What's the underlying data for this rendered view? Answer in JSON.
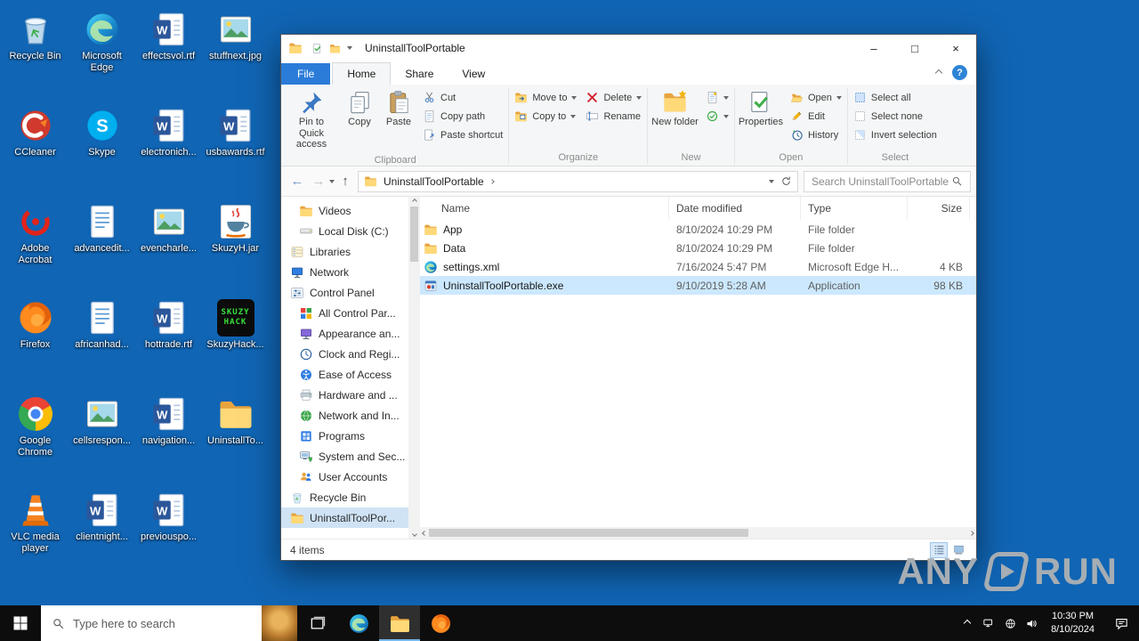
{
  "desktop": {
    "icons": [
      {
        "label": "Recycle Bin"
      },
      {
        "label": "CCleaner"
      },
      {
        "label": "Adobe Acrobat"
      },
      {
        "label": "Firefox"
      },
      {
        "label": "Google Chrome"
      },
      {
        "label": "VLC media player"
      },
      {
        "label": "Microsoft Edge"
      },
      {
        "label": "Skype"
      },
      {
        "label": "advancedit..."
      },
      {
        "label": "africanhad..."
      },
      {
        "label": "cellsrespon..."
      },
      {
        "label": "clientnight..."
      },
      {
        "label": "effectsvol.rtf"
      },
      {
        "label": "electronich..."
      },
      {
        "label": "evencharle..."
      },
      {
        "label": "hottrade.rtf"
      },
      {
        "label": "navigation..."
      },
      {
        "label": "previouspo..."
      },
      {
        "label": "stuffnext.jpg"
      },
      {
        "label": "usbawards.rtf"
      },
      {
        "label": "SkuzyH.jar"
      },
      {
        "label": "SkuzyHack..."
      },
      {
        "label": "UninstallTo..."
      }
    ],
    "skuzy_line1": "SKUZY",
    "skuzy_line2": "HACK"
  },
  "explorer": {
    "title": "UninstallToolPortable",
    "controls": {
      "minimize": "–",
      "maximize": "□",
      "close": "×",
      "help": "?"
    },
    "tabs": {
      "file": "File",
      "home": "Home",
      "share": "Share",
      "view": "View"
    },
    "ribbon": {
      "clipboard": {
        "label": "Clipboard",
        "pin": "Pin to Quick access",
        "copy": "Copy",
        "paste": "Paste",
        "cut": "Cut",
        "copy_path": "Copy path",
        "paste_shortcut": "Paste shortcut"
      },
      "organize": {
        "label": "Organize",
        "move_to": "Move to",
        "copy_to": "Copy to",
        "delete": "Delete",
        "rename": "Rename"
      },
      "new_group": {
        "label": "New",
        "new_folder": "New folder"
      },
      "open_group": {
        "label": "Open",
        "properties": "Properties",
        "open": "Open",
        "edit": "Edit",
        "history": "History"
      },
      "select_group": {
        "label": "Select",
        "select_all": "Select all",
        "select_none": "Select none",
        "invert": "Invert selection"
      }
    },
    "address": {
      "breadcrumb": "UninstallToolPortable",
      "search_placeholder": "Search UninstallToolPortable"
    },
    "nav": [
      {
        "label": "Videos"
      },
      {
        "label": "Local Disk (C:)"
      },
      {
        "label": "Libraries"
      },
      {
        "label": "Network"
      },
      {
        "label": "Control Panel"
      },
      {
        "label": "All Control Par..."
      },
      {
        "label": "Appearance an..."
      },
      {
        "label": "Clock and Regi..."
      },
      {
        "label": "Ease of Access"
      },
      {
        "label": "Hardware and ..."
      },
      {
        "label": "Network and In..."
      },
      {
        "label": "Programs"
      },
      {
        "label": "System and Sec..."
      },
      {
        "label": "User Accounts"
      },
      {
        "label": "Recycle Bin"
      },
      {
        "label": "UninstallToolPor..."
      }
    ],
    "list": {
      "columns": [
        "Name",
        "Date modified",
        "Type",
        "Size"
      ],
      "rows": [
        {
          "name": "App",
          "modified": "8/10/2024 10:29 PM",
          "type": "File folder",
          "size": ""
        },
        {
          "name": "Data",
          "modified": "8/10/2024 10:29 PM",
          "type": "File folder",
          "size": ""
        },
        {
          "name": "settings.xml",
          "modified": "7/16/2024 5:47 PM",
          "type": "Microsoft Edge H...",
          "size": "4 KB"
        },
        {
          "name": "UninstallToolPortable.exe",
          "modified": "9/10/2019 5:28 AM",
          "type": "Application",
          "size": "98 KB"
        }
      ]
    },
    "status": {
      "items_count": "4 items"
    }
  },
  "taskbar": {
    "search_placeholder": "Type here to search",
    "time": "10:30 PM",
    "date": "8/10/2024"
  },
  "watermark": {
    "left": "ANY",
    "right": "RUN"
  }
}
